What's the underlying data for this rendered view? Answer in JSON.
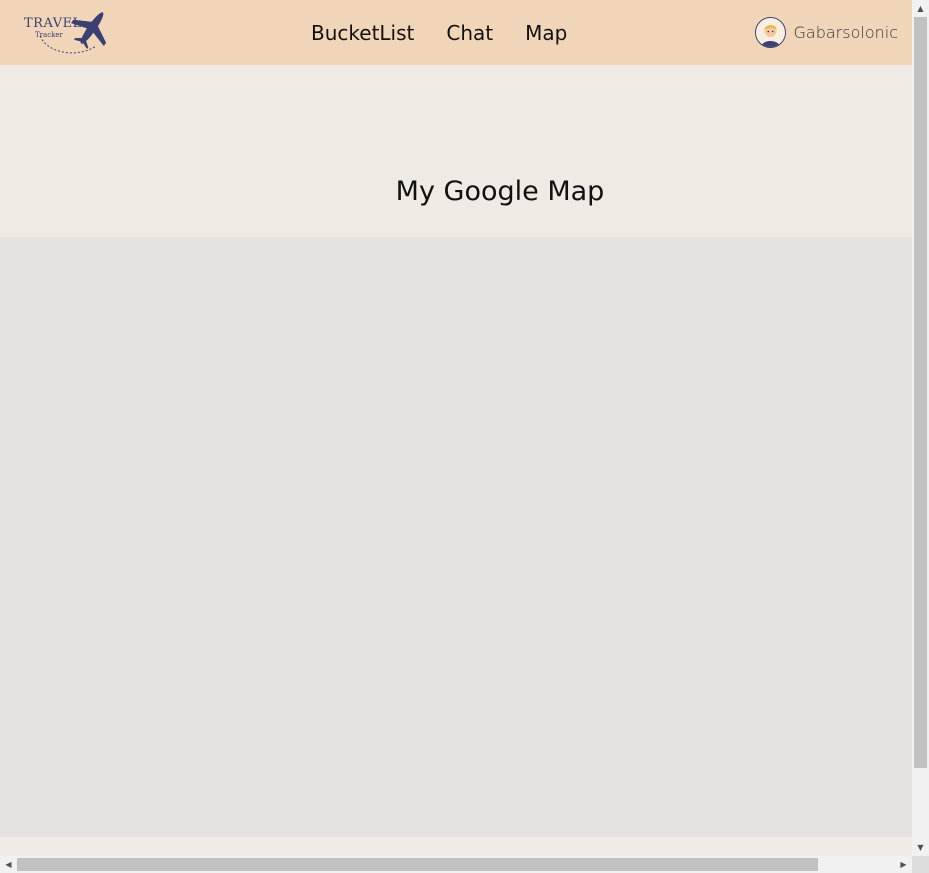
{
  "logo": {
    "word": "TRAVEL",
    "sub": "Tracker",
    "icon": "airplane-icon",
    "color": "#3b3f72"
  },
  "nav": {
    "links": [
      {
        "label": "BucketList"
      },
      {
        "label": "Chat"
      },
      {
        "label": "Map"
      }
    ]
  },
  "user": {
    "name": "Gabarsolonic",
    "avatar_icon": "user-avatar-icon"
  },
  "main": {
    "title": "My Google Map"
  },
  "colors": {
    "navbar": "#f1d5b9",
    "page_background": "#efebe4",
    "map_placeholder": "#e4e3df"
  },
  "icons": {
    "scroll_up": "▲",
    "scroll_down": "▼",
    "scroll_left": "◀",
    "scroll_right": "▶"
  }
}
